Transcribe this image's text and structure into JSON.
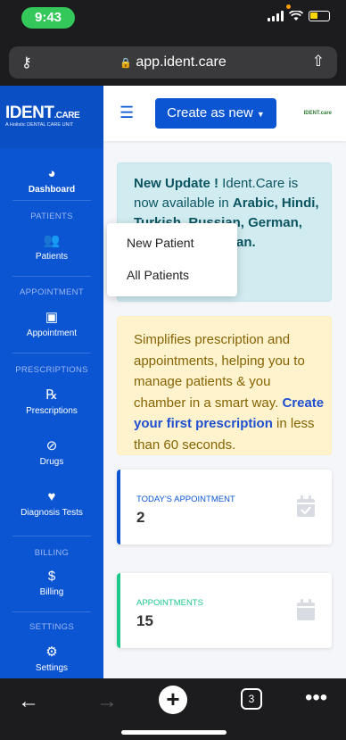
{
  "status": {
    "time": "9:43"
  },
  "browser": {
    "url": "app.ident.care",
    "lock": "🔒",
    "key_icon": "key-icon",
    "share_icon": "share-icon",
    "open_tabs": "3"
  },
  "brand": {
    "logo": "IDENT",
    "logo_suffix": ".CARE",
    "tagline": "A Holistic DENTAL CARE UNIT"
  },
  "sidebar": {
    "dashboard": "Dashboard",
    "sections": {
      "patients": "PATIENTS",
      "appointment": "APPOINTMENT",
      "prescriptions": "PRESCRIPTIONS",
      "billing": "BILLING",
      "settings": "SETTINGS"
    },
    "items": {
      "patients": "Patients",
      "appointment": "Appointment",
      "prescriptions": "Prescriptions",
      "drugs": "Drugs",
      "diagnosis": "Diagnosis Tests",
      "billing": "Billing",
      "settings": "Settings"
    }
  },
  "topbar": {
    "create_label": "Create as new",
    "mini_logo": "IDENT.care"
  },
  "update": {
    "lead": "New Update !",
    "text": " Ident.Care is now available in ",
    "langs": "Arabic, Hindi, Turkish, Russian, German, Italian and Persian."
  },
  "intro": {
    "text": "Simplifies prescription and appointments, helping you to manage patients & you chamber in a smart way. ",
    "link": "Create your first prescription",
    "tail": " in less than 60 seconds."
  },
  "stats": [
    {
      "label": "TODAY'S APPOINTMENT",
      "value": "2"
    },
    {
      "label": "APPOINTMENTS",
      "value": "15"
    }
  ],
  "popup": {
    "items": [
      "New Patient",
      "All Patients"
    ]
  },
  "colors": {
    "primary": "#0b55d2",
    "success": "#1cc88a",
    "info_bg": "#d1ecf1",
    "warn_bg": "#fff3cd"
  }
}
